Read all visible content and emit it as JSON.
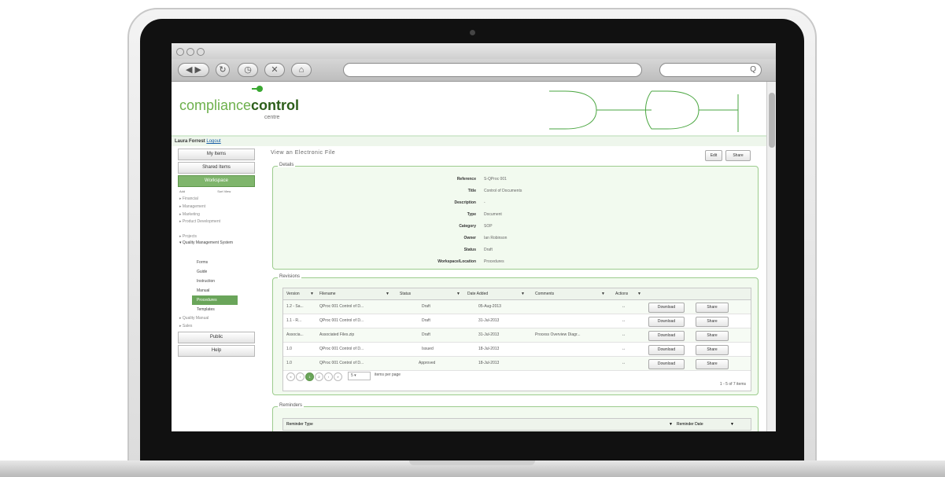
{
  "browser": {
    "search_placeholder": "Q"
  },
  "header": {
    "logo_part1": "compliance",
    "logo_part2": "control",
    "logo_sub": "centre"
  },
  "user": {
    "name": "Laura Forrest",
    "logout": "Logout"
  },
  "sidebar": {
    "my_items": "My Items",
    "shared_items": "Shared Items",
    "workspace": "Workspace",
    "mini_left": "Add",
    "mini_right": "Sort View",
    "items": [
      "Financial",
      "Management",
      "Marketing",
      "Product Development",
      "Projects",
      "Quality Management System"
    ],
    "subitems": [
      "Forms",
      "Guide",
      "Instruction",
      "Manual",
      "Procedures",
      "Templates"
    ],
    "items_after": [
      "Quality Manual",
      "Sales"
    ],
    "public": "Public",
    "help": "Help"
  },
  "main": {
    "title": "View an Electronic File",
    "edit": "Edit",
    "share": "Share",
    "details_title": "Details",
    "details": [
      {
        "label": "Reference",
        "value": "S-QProc 001"
      },
      {
        "label": "Title",
        "value": "Control of Documents"
      },
      {
        "label": "Description",
        "value": "-"
      },
      {
        "label": "Type",
        "value": "Document"
      },
      {
        "label": "Category",
        "value": "SOP"
      },
      {
        "label": "Owner",
        "value": "Ian Robinson"
      },
      {
        "label": "Status",
        "value": "Draft"
      },
      {
        "label": "Workspace/Location",
        "value": "Procedures"
      }
    ],
    "revisions_title": "Revisions",
    "columns": [
      "Version",
      "Filename",
      "Status",
      "Date Added",
      "Comments",
      "Actions"
    ],
    "rows": [
      {
        "version": "1.2 - Sa...",
        "filename": "QProc 001 Control of D...",
        "status": "Draft",
        "date": "05-Aug-2013",
        "comments": "",
        "actions": "↔"
      },
      {
        "version": "1.1 - R...",
        "filename": "QProc 001 Control of D...",
        "status": "Draft",
        "date": "31-Jul-2013",
        "comments": "",
        "actions": "↔"
      },
      {
        "version": "Associa...",
        "filename": "Associated Files.zip",
        "status": "Draft",
        "date": "31-Jul-2013",
        "comments": "Process Overview Diagr...",
        "actions": "↔"
      },
      {
        "version": "1.0",
        "filename": "QProc 001 Control of D...",
        "status": "Issued",
        "date": "18-Jul-2013",
        "comments": "",
        "actions": "↔"
      },
      {
        "version": "1.0",
        "filename": "QProc 001 Control of D...",
        "status": "Approved",
        "date": "18-Jul-2013",
        "comments": "",
        "actions": "↔"
      }
    ],
    "download_label": "Download",
    "share_label": "Share",
    "pager": {
      "page1": "1",
      "page2": "2",
      "page_size": "5",
      "items_per_page": "items per page",
      "summary": "1 - 5 of 7 items"
    },
    "reminders_title": "Reminders",
    "reminder_type": "Reminder Type",
    "reminder_date": "Reminder Date"
  }
}
